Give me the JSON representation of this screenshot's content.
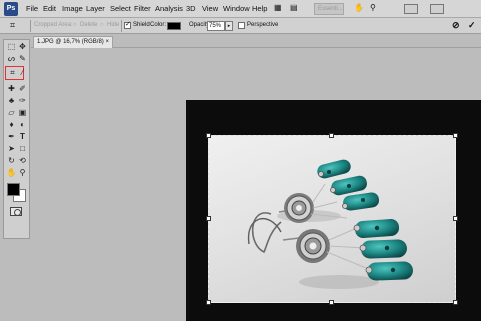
{
  "app": {
    "logo_text": "Ps"
  },
  "menubar": {
    "items": [
      "File",
      "Edit",
      "Image",
      "Layer",
      "Select",
      "Filter",
      "Analysis",
      "3D",
      "View",
      "Window",
      "Help"
    ],
    "zoom_value": "Essenti..."
  },
  "options_bar": {
    "cropped_area_label": "Cropped Area:",
    "delete_label": "Delete",
    "hide_label": "Hide",
    "shield_label": "Shield",
    "shield_checked": true,
    "color_label": "Color:",
    "shield_color": "#000000",
    "opacity_label": "Opacity:",
    "opacity_value": "75%",
    "perspective_label": "Perspective",
    "perspective_checked": false
  },
  "tools": {
    "icons": [
      "move-icon",
      "marquee-icon",
      "lasso-icon",
      "quick-selection-icon",
      "crop-icon",
      "eyedropper-icon",
      "healing-icon",
      "brush-icon",
      "clone-stamp-icon",
      "history-brush-icon",
      "eraser-icon",
      "gradient-icon",
      "blur-icon",
      "dodge-icon",
      "pen-icon",
      "type-icon",
      "path-selection-icon",
      "shape-icon",
      "3d-rotate-icon",
      "3d-orbit-icon",
      "hand-icon",
      "zoom-icon"
    ],
    "selected": "crop-icon",
    "foreground_color": "#000000",
    "background_color": "#ffffff"
  },
  "document": {
    "tab_title": "1.JPG @ 16,7% (RGB/8)",
    "close_glyph": "×"
  },
  "colors": {
    "accent": "#e23030",
    "stone": "#1e8a86"
  }
}
